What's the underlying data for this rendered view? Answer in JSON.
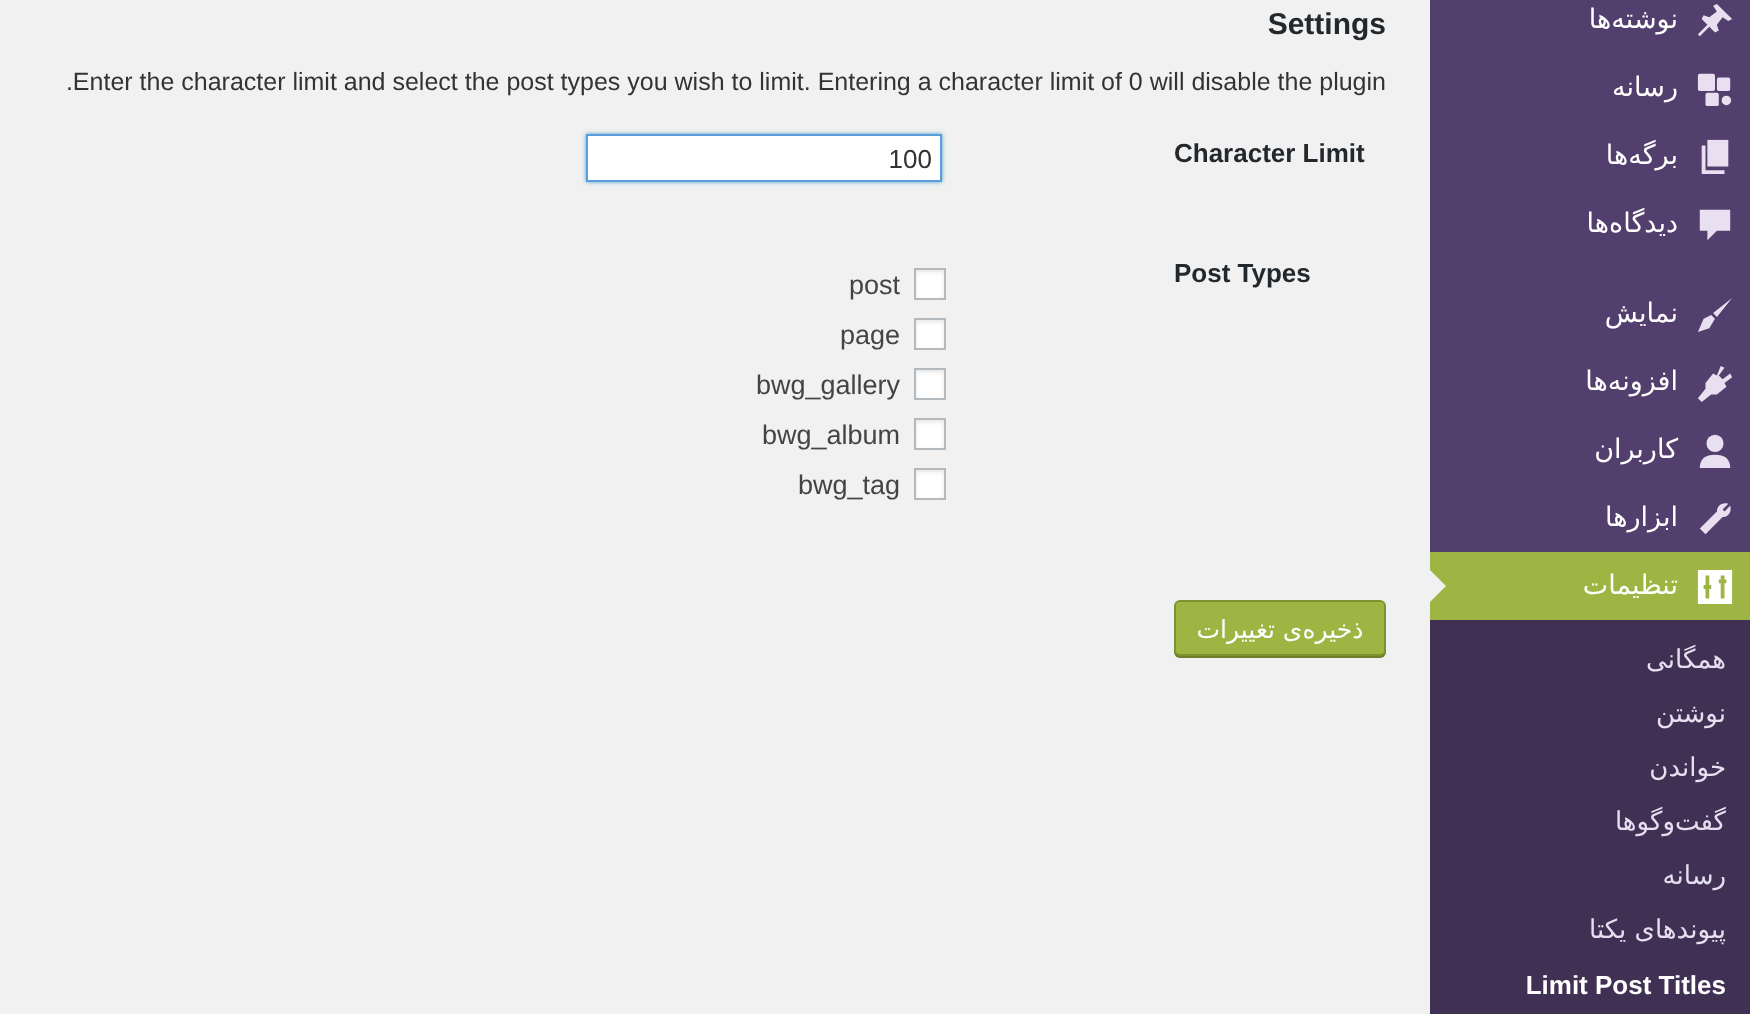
{
  "main": {
    "title": "Settings",
    "description": ".Enter the character limit and select the post types you wish to limit. Entering a character limit of 0 will disable the plugin",
    "character_limit": {
      "label": "Character Limit",
      "value": "100"
    },
    "post_types": {
      "label": "Post Types",
      "options": [
        {
          "label": "post",
          "checked": false
        },
        {
          "label": "page",
          "checked": false
        },
        {
          "label": "bwg_gallery",
          "checked": false
        },
        {
          "label": "bwg_album",
          "checked": false
        },
        {
          "label": "bwg_tag",
          "checked": false
        }
      ]
    },
    "save_button": "ذخیره‌ی تغییرات"
  },
  "sidebar": {
    "groups": [
      {
        "items": [
          {
            "label": "نوشته‌ها",
            "selected": false
          },
          {
            "label": "رسانه",
            "selected": false
          },
          {
            "label": "برگه‌ها",
            "selected": false
          },
          {
            "label": "دیدگاه‌ها",
            "selected": false
          }
        ]
      },
      {
        "items": [
          {
            "label": "نمایش",
            "selected": false
          },
          {
            "label": "افزونه‌ها",
            "selected": false
          },
          {
            "label": "کاربران",
            "selected": false
          },
          {
            "label": "ابزارها",
            "selected": false
          },
          {
            "label": "تنظیمات",
            "selected": true
          }
        ]
      }
    ],
    "submenu": [
      {
        "label": "همگانی",
        "selected": false
      },
      {
        "label": "نوشتن",
        "selected": false
      },
      {
        "label": "خواندن",
        "selected": false
      },
      {
        "label": "گفت‌وگوها",
        "selected": false
      },
      {
        "label": "رسانه",
        "selected": false
      },
      {
        "label": "پیوندهای یکتا",
        "selected": false
      },
      {
        "label": "Limit Post Titles",
        "selected": true
      }
    ]
  }
}
